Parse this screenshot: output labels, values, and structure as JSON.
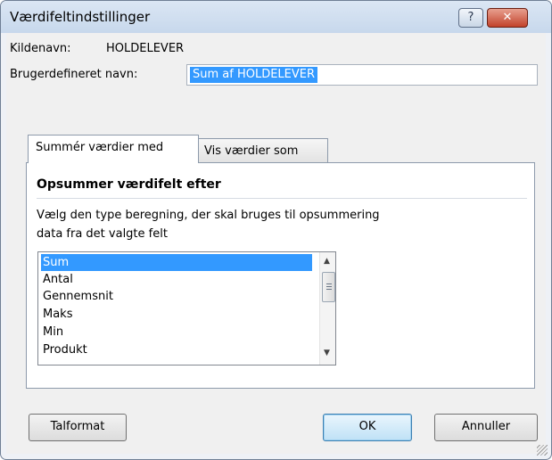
{
  "window": {
    "title": "Værdifeltindstillinger",
    "help_label": "?",
    "close_label": "✕"
  },
  "source": {
    "label": "Kildenavn:",
    "value": "HOLDELEVER"
  },
  "custom_name": {
    "label": "Brugerdefineret navn:",
    "value": "Sum af HOLDELEVER"
  },
  "tabs": [
    {
      "label": "Summér værdier med",
      "active": true
    },
    {
      "label": "Vis værdier som",
      "active": false
    }
  ],
  "panel": {
    "heading": "Opsummer værdifelt efter",
    "description_line1": "Vælg den type beregning, der skal bruges til opsummering",
    "description_line2": "data fra det valgte felt",
    "options": [
      "Sum",
      "Antal",
      "Gennemsnit",
      "Maks",
      "Min",
      "Produkt"
    ],
    "selected": "Sum"
  },
  "buttons": {
    "number_format": "Talformat",
    "ok": "OK",
    "cancel": "Annuller"
  }
}
